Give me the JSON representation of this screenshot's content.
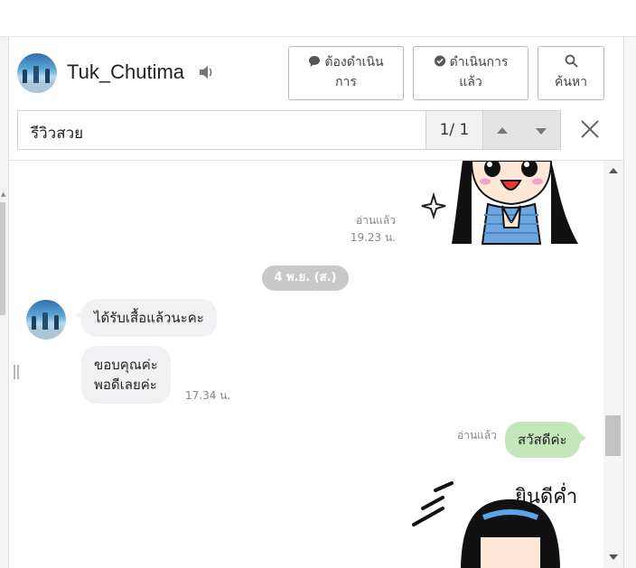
{
  "header": {
    "username": "Tuk_Chutima",
    "buttons": {
      "todo_line1": "ต้องดำเนิน",
      "todo_line2": "การ",
      "done_line1": "ดำเนินการ",
      "done_line2": "แล้ว",
      "search": "ค้นหา"
    }
  },
  "search": {
    "query": "รีวิวสวย",
    "count": "1/ 1"
  },
  "messages": {
    "read1": "อ่านแล้ว",
    "time1": "19.23 น.",
    "date_separator": "4 พ.ย. (ส.)",
    "in1": "ได้รับเสื้อแล้วนะคะ",
    "in2_line1": "ขอบคุณค่ะ",
    "in2_line2": "พอดีเลยค่ะ",
    "in_time": "17.34 น.",
    "read2": "อ่านแล้ว",
    "out1": "สวัสดีค่ะ",
    "sticker_caption": "ยินดีค่ำ"
  },
  "colors": {
    "outgoing_bubble": "#c3e7bb",
    "incoming_bubble": "#f1f1f3",
    "date_pill": "#c8c8c8"
  }
}
